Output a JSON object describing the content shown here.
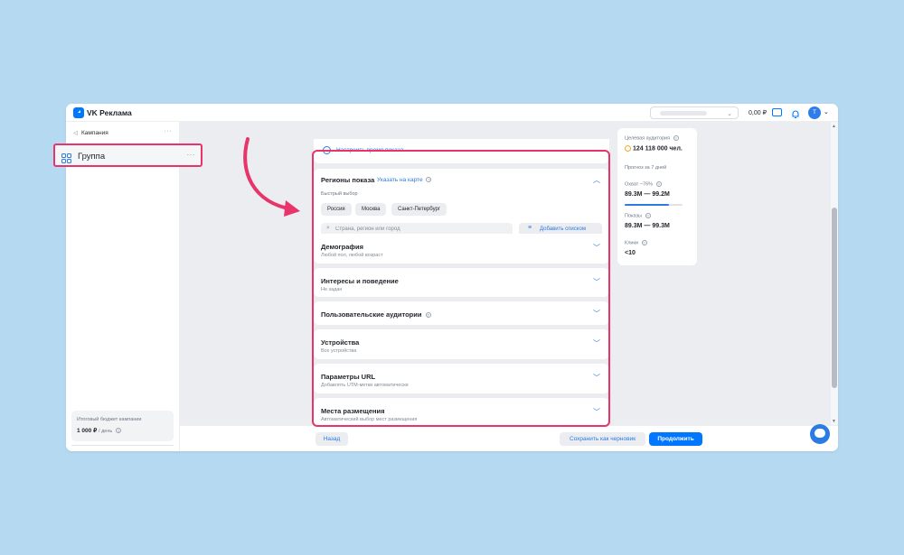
{
  "app": {
    "title": "VK Реклама"
  },
  "topbar": {
    "balance": "0,00 ₽",
    "avatar_letter": "T"
  },
  "sidebar": {
    "campaign_label": "Кампания",
    "group_label": "Группа",
    "budget_label": "Итоговый бюджет кампании",
    "budget_value": "1 000 ₽",
    "budget_period": "/ день"
  },
  "main": {
    "time_link": "Настроить время показа",
    "regions": {
      "title": "Регионы показа",
      "map_link": "Указать на карте",
      "quick_label": "Быстрый выбор",
      "chips": [
        "Россия",
        "Москва",
        "Санкт-Петербург"
      ],
      "search_placeholder": "Страна, регион или город",
      "add_list_label": "Добавить списком"
    },
    "sections": [
      {
        "title": "Демография",
        "subtitle": "Любой пол, любой возраст"
      },
      {
        "title": "Интересы и поведение",
        "subtitle": "Не задан"
      },
      {
        "title": "Пользовательские аудитории",
        "subtitle": ""
      },
      {
        "title": "Устройства",
        "subtitle": "Все устройства"
      },
      {
        "title": "Параметры URL",
        "subtitle": "Добавлять UTM-метки автоматически"
      },
      {
        "title": "Места размещения",
        "subtitle": "Автоматический выбор мест размещения"
      }
    ]
  },
  "forecast": {
    "audience_label": "Целевая аудитория",
    "audience_value": "124 118 000 чел.",
    "period_label": "Прогноз за 7 дней",
    "reach_label": "Охват ~76%",
    "reach_value": "89.3M — 99.2M",
    "reach_fraction": 0.76,
    "impressions_label": "Показы",
    "impressions_value": "89.3M — 99.3M",
    "clicks_label": "Клики",
    "clicks_value": "<10"
  },
  "bottombar": {
    "back_label": "Назад",
    "draft_label": "Сохранить как черновик",
    "continue_label": "Продолжить"
  },
  "colors": {
    "accent": "#0077ff",
    "highlight": "#e8336b",
    "background": "#b6d9f2"
  }
}
